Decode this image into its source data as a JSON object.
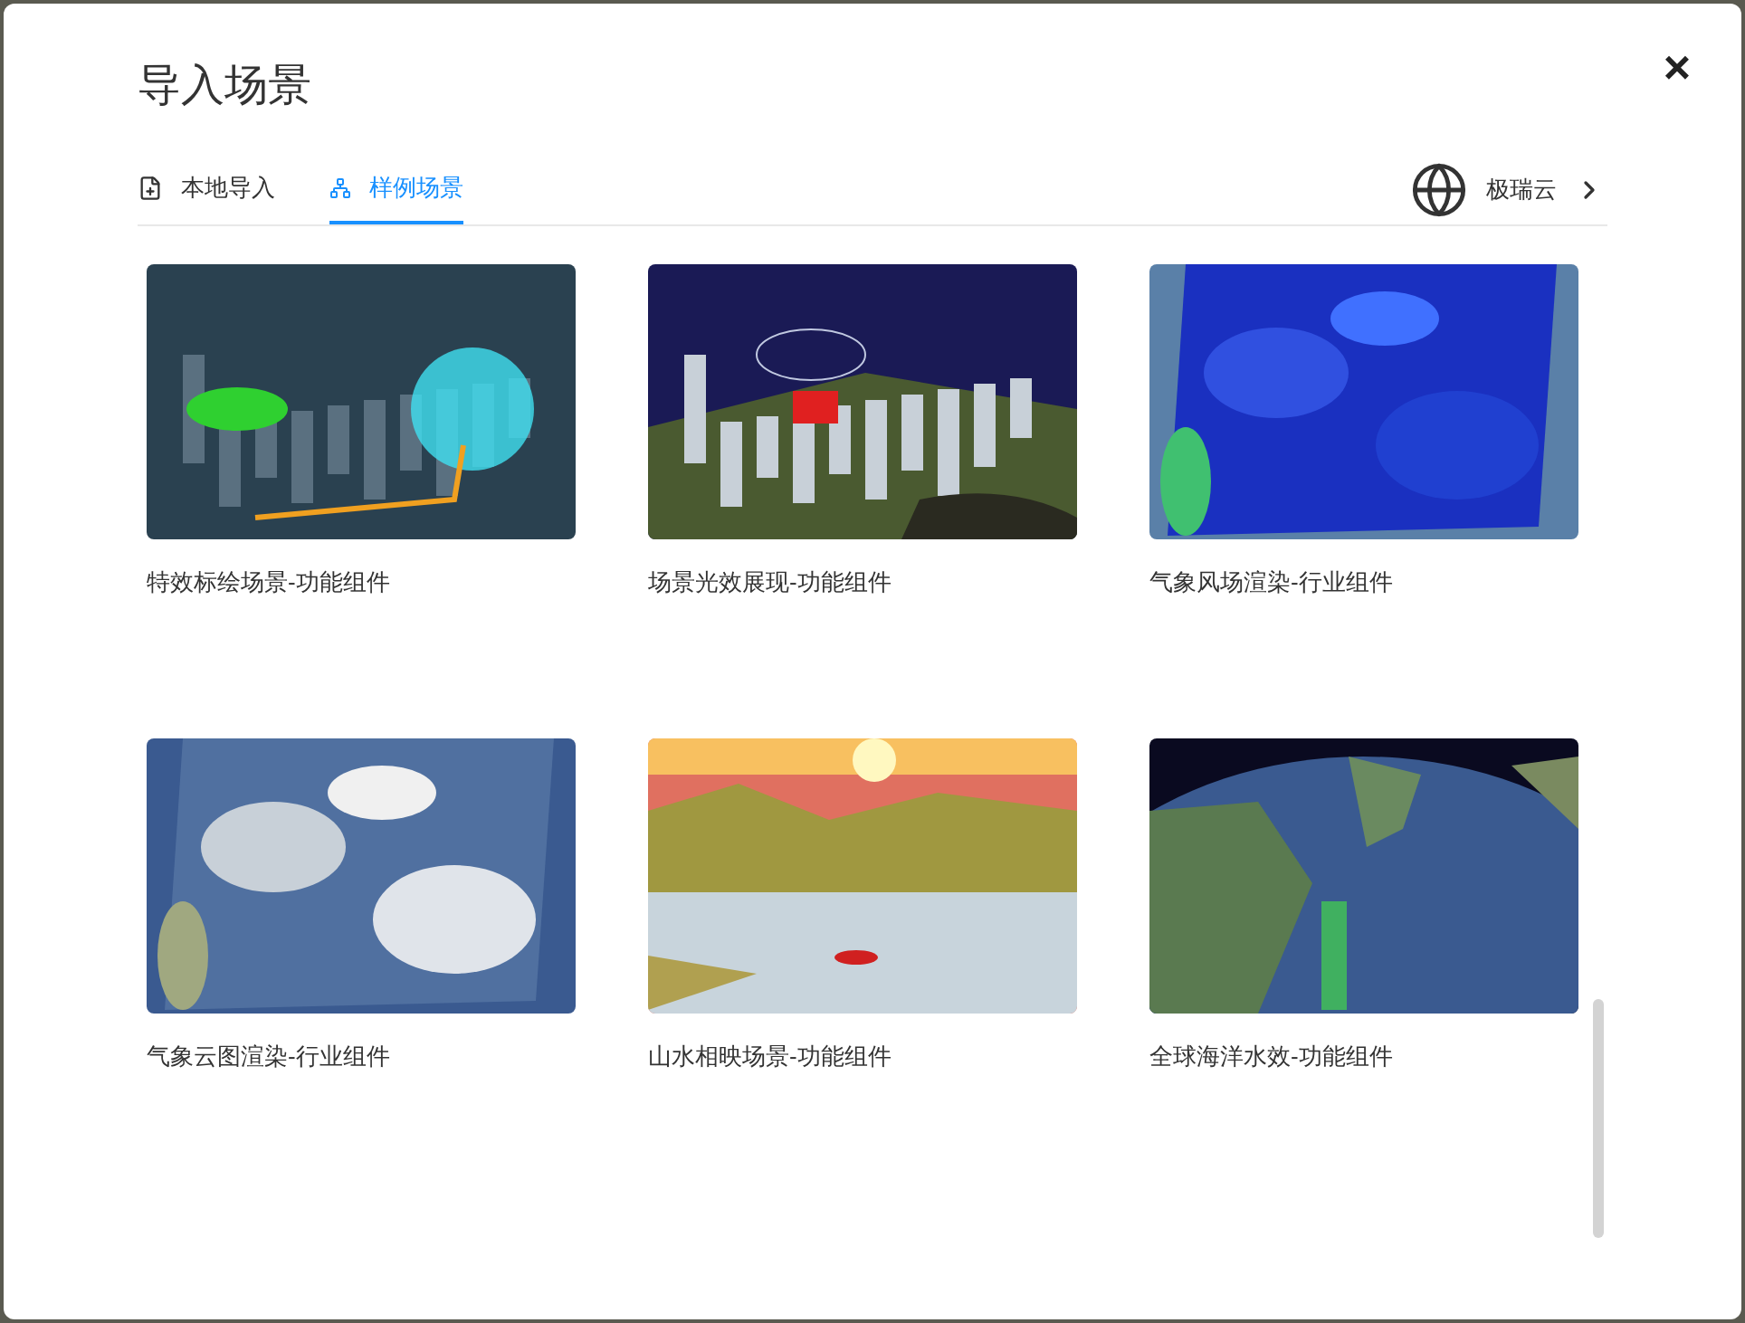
{
  "dialog": {
    "title": "导入场景",
    "close": "×"
  },
  "tabs": [
    {
      "label": "本地导入",
      "selected": false,
      "kind": "file"
    },
    {
      "label": "样例场景",
      "selected": true,
      "kind": "sample"
    }
  ],
  "cloud_link": {
    "label": "极瑞云"
  },
  "scenes": [
    {
      "title": "特效标绘场景-功能组件",
      "kind": "picture"
    },
    {
      "title": "场景光效展现-功能组件",
      "kind": "picture"
    },
    {
      "title": "气象风场渲染-行业组件",
      "kind": "picture"
    },
    {
      "title": "气象云图渲染-行业组件",
      "kind": "picture"
    },
    {
      "title": "山水相映场景-功能组件",
      "kind": "picture"
    },
    {
      "title": "全球海洋水效-功能组件",
      "kind": "picture"
    }
  ]
}
